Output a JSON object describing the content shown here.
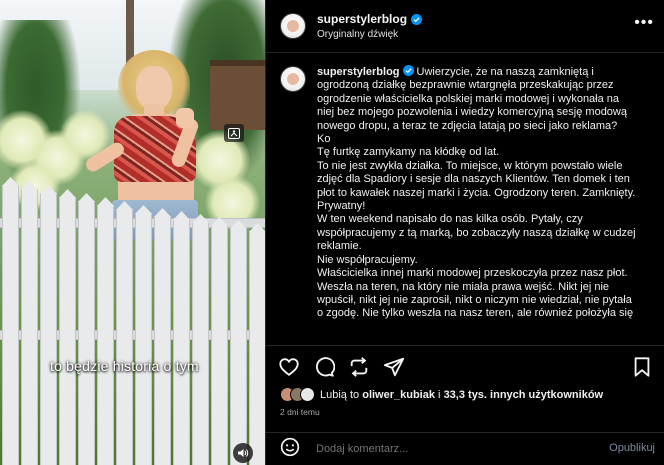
{
  "video": {
    "caption": "to będzie historia o tym"
  },
  "header": {
    "username": "superstylerblog",
    "audio_label": "Oryginalny dźwięk",
    "more_icon": "more-horizontal-icon"
  },
  "post": {
    "username": "superstylerblog",
    "lines": [
      "Uwierzycie, że na naszą zamkniętą i",
      "ogrodzoną działkę bezprawnie wtargnęła przeskakując przez",
      "ogrodzenie właścicielka polskiej marki modowej i wykonała na",
      "niej bez mojego pozwolenia i wiedzy komercyjną sesję modową",
      "nowego dropu, a teraz te zdjęcia latają po sieci jako reklama?",
      "Ko",
      "Tę furtkę zamykamy na kłódkę od lat.",
      "To nie jest zwykła działka. To miejsce, w którym powstało wiele",
      "zdjęć dla Spadiory i sesje dla naszych Klientów. Ten domek i ten",
      "płot to kawałek naszej marki i życia. Ogrodzony teren. Zamknięty.",
      "Prywatny!",
      "W ten weekend napisało do nas kilka osób. Pytały, czy",
      "współpracujemy z tą marką, bo zobaczyły naszą działkę w cudzej",
      "reklamie.",
      "Nie współpracujemy.",
      "Właścicielka innej marki modowej przeskoczyła przez nasz płot.",
      "Weszła na teren, na który nie miała prawa wejść. Nikt jej nie",
      "wpuścił, nikt jej nie zaprosił, nikt o niczym nie wiedział, nie pytała",
      "o zgodę. Nie tylko weszła na nasz teren, ale również położyła się"
    ]
  },
  "actions": {
    "icons": [
      "heart-icon",
      "comment-icon",
      "repost-icon",
      "share-icon",
      "bookmark-icon"
    ]
  },
  "likes": {
    "prefix": "Lubią to",
    "user": "oliwer_kubiak",
    "middle": "i",
    "count_text": "33,3 tys. innych użytkowników"
  },
  "date": "2 dni temu",
  "comment": {
    "placeholder": "Dodaj komentarz...",
    "publish_label": "Opublikuj"
  },
  "colors": {
    "background": "#000000",
    "verified_blue": "#0095f6",
    "muted_text": "#a8a8a8",
    "divider": "#262626"
  }
}
